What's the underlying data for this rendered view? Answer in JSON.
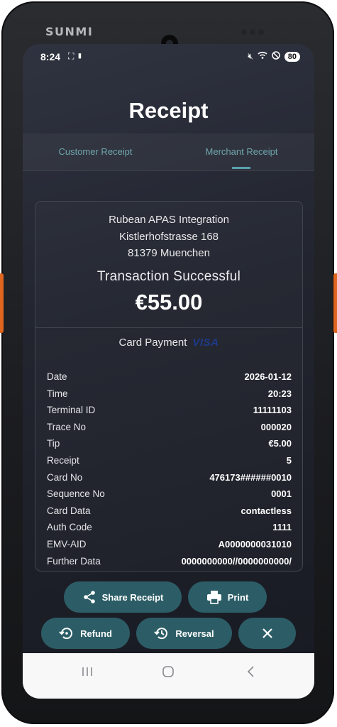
{
  "device": {
    "brand": "SUNMI"
  },
  "statusbar": {
    "time": "8:24",
    "battery": "80"
  },
  "header": {
    "title": "Receipt"
  },
  "tabs": [
    {
      "label": "Customer Receipt",
      "selected": false
    },
    {
      "label": "Merchant Receipt",
      "selected": true
    }
  ],
  "receipt": {
    "merchant_name": "Rubean APAS Integration",
    "street": "Kistlerhofstrasse 168",
    "city": "81379 Muenchen",
    "status": "Transaction Successful",
    "amount": "€55.00",
    "payment_type": "Card Payment",
    "card_brand": "VISA",
    "rows": [
      {
        "label": "Date",
        "value": "2026-01-12"
      },
      {
        "label": "Time",
        "value": "20:23"
      },
      {
        "label": "Terminal ID",
        "value": "11111103"
      },
      {
        "label": "Trace No",
        "value": "000020"
      },
      {
        "label": "Tip",
        "value": "€5.00"
      },
      {
        "label": "Receipt",
        "value": "5"
      },
      {
        "label": "Card No",
        "value": "476173######0010"
      },
      {
        "label": "Sequence No",
        "value": "0001"
      },
      {
        "label": "Card Data",
        "value": "contactless"
      },
      {
        "label": "Auth Code",
        "value": "1111"
      },
      {
        "label": "EMV-AID",
        "value": "A0000000031010"
      },
      {
        "label": "Further Data",
        "value": "0000000000//0000000000/"
      }
    ]
  },
  "actions": {
    "share_label": "Share Receipt",
    "print_label": "Print",
    "refund_label": "Refund",
    "reversal_label": "Reversal"
  },
  "colors": {
    "button": "#2c5d66",
    "tab_accent": "#5aa0aa",
    "screen_bg": "#22252f"
  }
}
